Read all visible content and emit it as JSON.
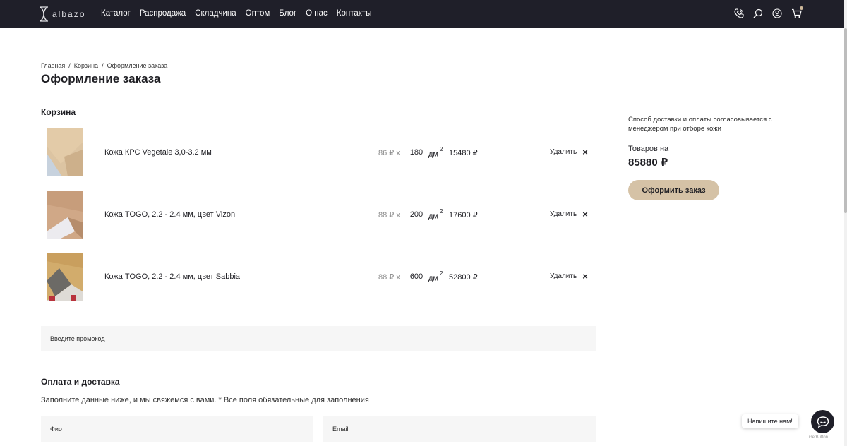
{
  "header": {
    "logo_text": "albazo",
    "nav": [
      "Каталог",
      "Распродажа",
      "Складчина",
      "Оптом",
      "Блог",
      "О нас",
      "Контакты"
    ],
    "icons": [
      "phone-icon",
      "search-icon",
      "user-icon",
      "cart-icon"
    ],
    "colors": {
      "bar": "#1f1f29",
      "accent": "#d5c2a6"
    }
  },
  "breadcrumb": [
    "Главная",
    "Корзина",
    "Оформление заказа"
  ],
  "breadcrumb_sep": "/",
  "page_title": "Оформление заказа",
  "cart": {
    "title": "Корзина",
    "items": [
      {
        "name": "Кожа КРС Vegetale 3,0-3.2 мм",
        "price": "86 ₽",
        "times": "x",
        "qty": "180",
        "unit": "дм",
        "unit_sup": "2",
        "sum": "15480 ₽",
        "remove": "Удалить"
      },
      {
        "name": "Кожа TOGO, 2.2 - 2.4 мм, цвет Vizon",
        "price": "88 ₽",
        "times": "x",
        "qty": "200",
        "unit": "дм",
        "unit_sup": "2",
        "sum": "17600 ₽",
        "remove": "Удалить"
      },
      {
        "name": "Кожа TOGO, 2.2 - 2.4 мм, цвет Sabbia",
        "price": "88 ₽",
        "times": "x",
        "qty": "600",
        "unit": "дм",
        "unit_sup": "2",
        "sum": "52800 ₽",
        "remove": "Удалить"
      }
    ]
  },
  "promo": {
    "placeholder": "Введите промокод"
  },
  "payment": {
    "title": "Оплата и доставка",
    "description": "Заполните данные ниже, и мы свяжемся с вами. * Все поля обязательные для заполнения",
    "fio_placeholder": "Фио",
    "email_placeholder": "Email"
  },
  "sidebar": {
    "note": "Способ доставки и оплаты согласовывается с менеджером при отборе кожи",
    "total_label": "Товаров на",
    "total_value": "85880 ₽",
    "checkout": "Оформить заказ"
  },
  "chat": {
    "label": "Напишите нам!",
    "brand": "GetButton"
  }
}
